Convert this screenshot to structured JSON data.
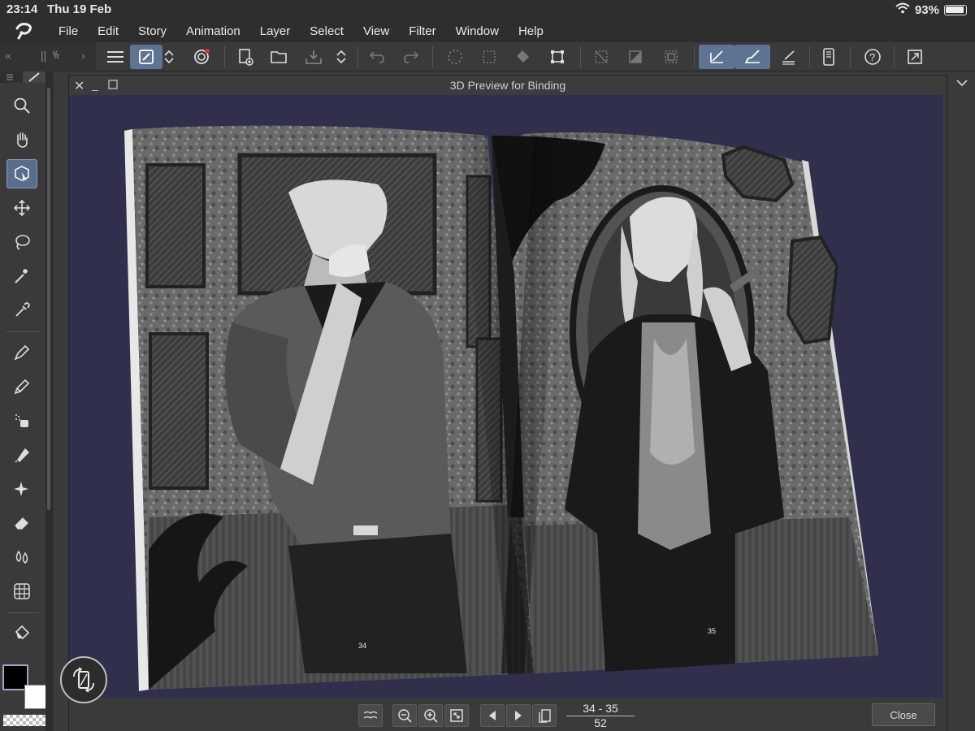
{
  "status_bar": {
    "time": "23:14",
    "date": "Thu 19 Feb",
    "battery": "93%"
  },
  "menu": [
    "File",
    "Edit",
    "Story",
    "Animation",
    "Layer",
    "Select",
    "View",
    "Filter",
    "Window",
    "Help"
  ],
  "toolbar_icons": [
    "menu-icon",
    "color-mixer-icon",
    "updown-icon",
    "spiral-icon",
    "new-page-icon",
    "open-folder-icon",
    "save-icon",
    "updown-icon",
    "undo-icon",
    "redo-icon",
    "loading-icon",
    "transform-icon",
    "fill-icon",
    "crop-icon",
    "clear-selection-icon",
    "invert-selection-icon",
    "selection-border-icon",
    "pen-ruler-icon",
    "brush-ruler-icon",
    "ruler-icon",
    "device-icon",
    "help-icon",
    "fullscreen-icon"
  ],
  "tools": [
    "zoom-icon",
    "hand-icon",
    "object-select-icon",
    "move-icon",
    "lasso-icon",
    "magic-wand-icon",
    "eyedropper-icon",
    "pen-icon",
    "pencil-icon",
    "airbrush-icon",
    "marker-icon",
    "sparkle-icon",
    "eraser-icon",
    "blend-icon",
    "grid-icon",
    "fill-bucket-icon"
  ],
  "preview": {
    "title": "3D Preview for Binding",
    "page_range": "34 - 35",
    "page_total": "52",
    "close_label": "Close",
    "left_page_number": "34",
    "right_page_number": "35"
  },
  "colors": {
    "viewport_bg": "#30304d",
    "accent": "#5f7393",
    "foreground": "#000000",
    "background": "#ffffff"
  }
}
